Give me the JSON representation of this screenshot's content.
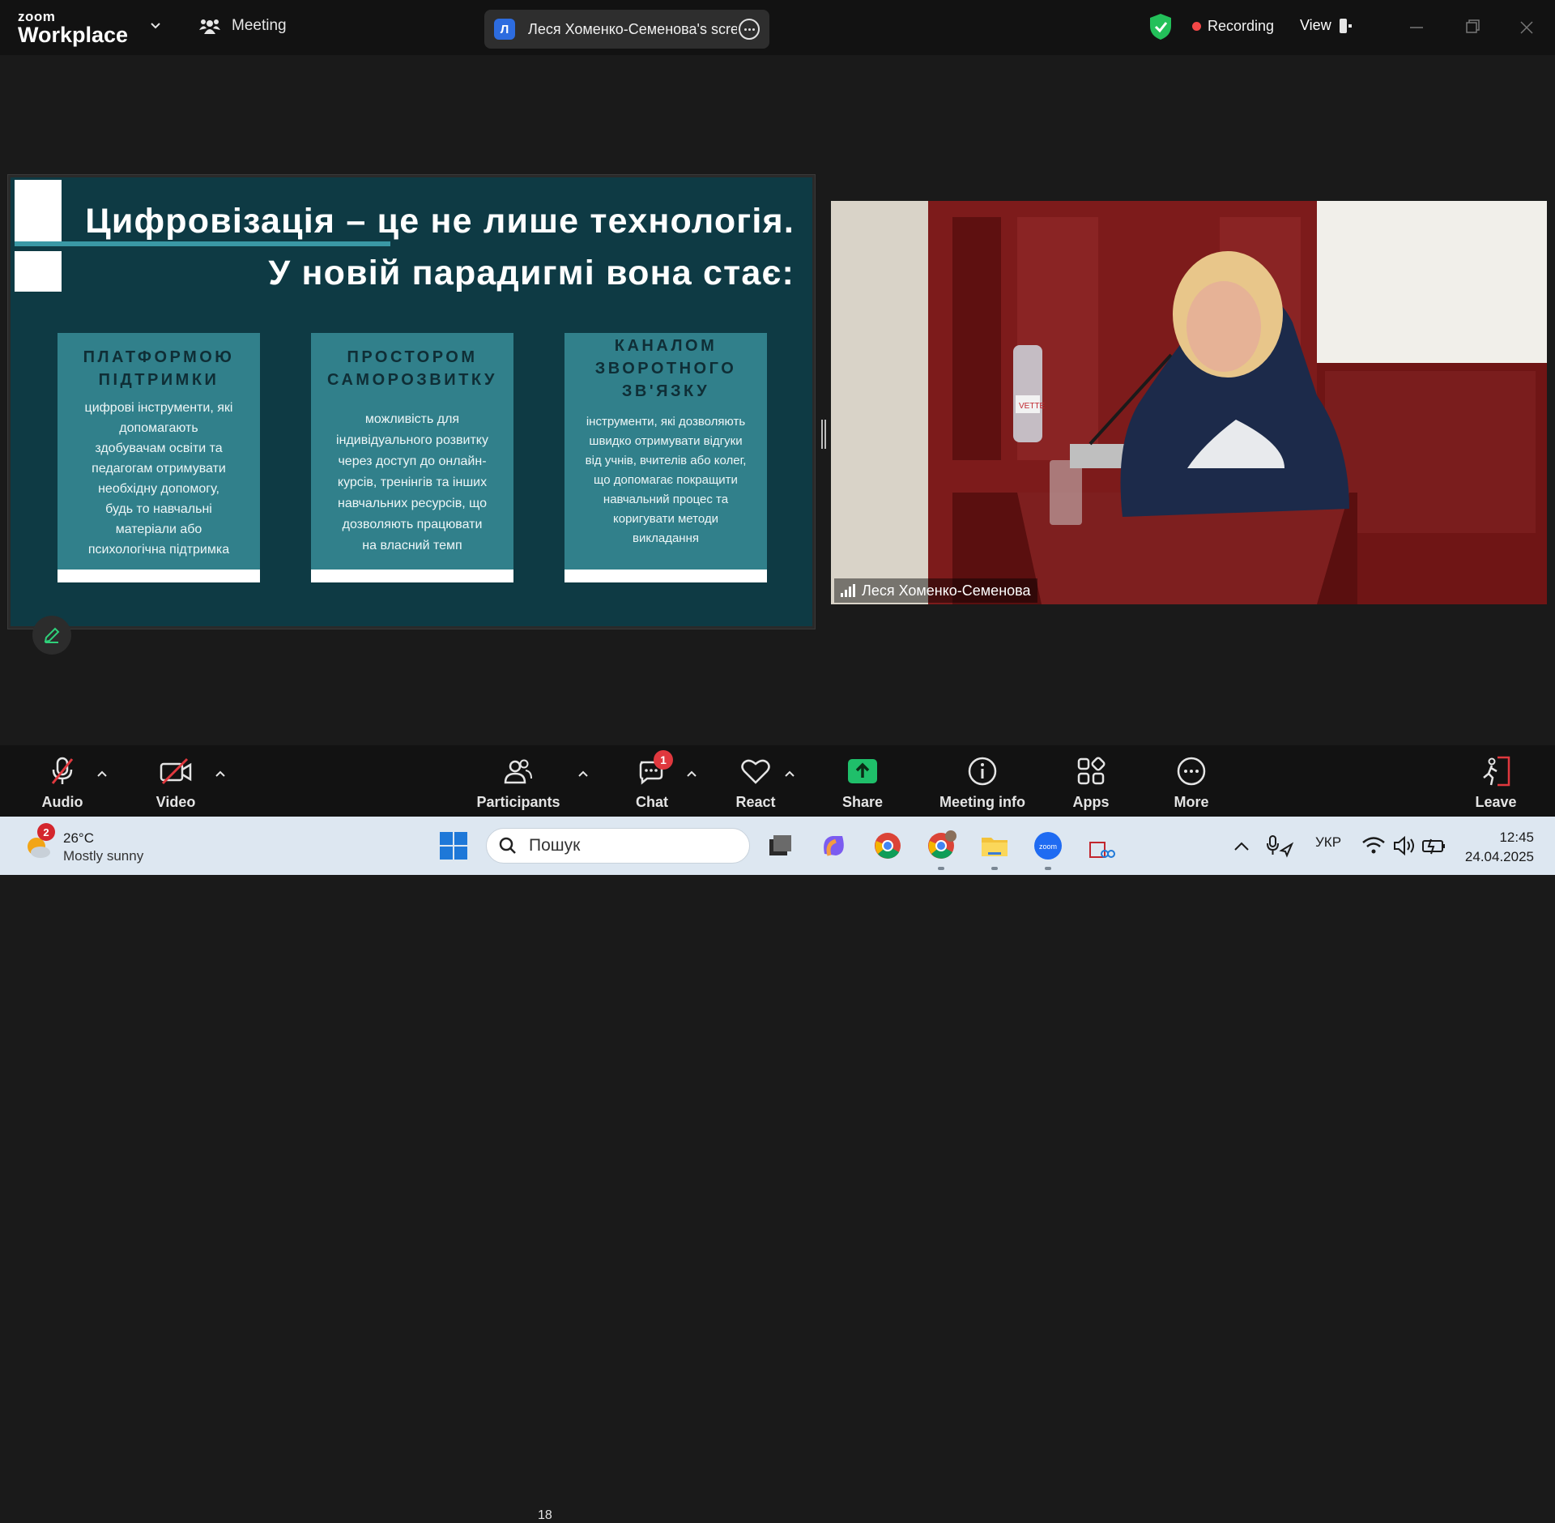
{
  "app": {
    "logo_line1": "zoom",
    "logo_line2": "Workplace",
    "meeting_tab": "Meeting",
    "share_initial": "Л",
    "share_title": "Леся Хоменко-Семенова's scree",
    "recording_label": "Recording",
    "view_label": "View"
  },
  "slide": {
    "title_line1": "Цифровізація – це не лише технологія.",
    "title_line2": "У новій парадигмі вона стає:",
    "cards": [
      {
        "heading_lines": [
          "ПЛАТФОРМОЮ",
          "ПІДТРИМКИ"
        ],
        "body_lines": [
          "цифрові інструменти, які",
          "допомагають",
          "здобувачам освіти та",
          "педагогам отримувати",
          "необхідну допомогу,",
          "будь то навчальні",
          "матеріали або",
          "психологічна підтримка"
        ]
      },
      {
        "heading_lines": [
          "ПРОСТОРОМ",
          "САМОРОЗВИТКУ"
        ],
        "body_lines": [
          "можливість для",
          "індивідуального розвитку",
          "через доступ до онлайн-",
          "курсів, тренінгів та інших",
          "навчальних ресурсів, що",
          "дозволяють працювати",
          "на власний темп"
        ]
      },
      {
        "heading_lines": [
          "КАНАЛОМ",
          "ЗВОРОТНОГО",
          "ЗВ'ЯЗКУ"
        ],
        "body_lines": [
          "інструменти, які дозволяють",
          "швидко отримувати відгуки",
          "від учнів, вчителів або колег,",
          "що допомагає покращити",
          "навчальний процес та",
          "коригувати методи",
          "викладання"
        ]
      }
    ]
  },
  "video": {
    "participant_name": "Леся Хоменко-Семенова",
    "bottle_label": "VETTE"
  },
  "toolbar": {
    "audio": "Audio",
    "video": "Video",
    "participants": "Participants",
    "participants_count": "18",
    "chat": "Chat",
    "chat_badge": "1",
    "react": "React",
    "share": "Share",
    "meeting_info": "Meeting info",
    "apps": "Apps",
    "more": "More",
    "leave": "Leave"
  },
  "taskbar": {
    "weather_badge": "2",
    "temperature": "26°C",
    "weather_desc": "Mostly sunny",
    "search_placeholder": "Пошук",
    "language": "УКР",
    "time": "12:45",
    "date": "24.04.2025"
  },
  "colors": {
    "slide_bg": "#0e3a44",
    "card_bg": "#31808b",
    "accent_teal": "#3a98a5",
    "recording_red": "#f44747",
    "share_green": "#1fbf6a",
    "toolbar_bg": "#121212"
  },
  "icons": [
    "chevron-down-icon",
    "meeting-icon",
    "more-icon",
    "shield-check-icon",
    "view-icon",
    "minimize-icon",
    "maximize-icon",
    "close-icon",
    "pen-icon",
    "mic-off-icon",
    "video-off-icon",
    "participants-icon",
    "chat-icon",
    "heart-icon",
    "share-arrow-icon",
    "info-icon",
    "apps-icon",
    "more-icon",
    "leave-icon",
    "windows-start-icon",
    "search-icon",
    "signal-icon"
  ]
}
